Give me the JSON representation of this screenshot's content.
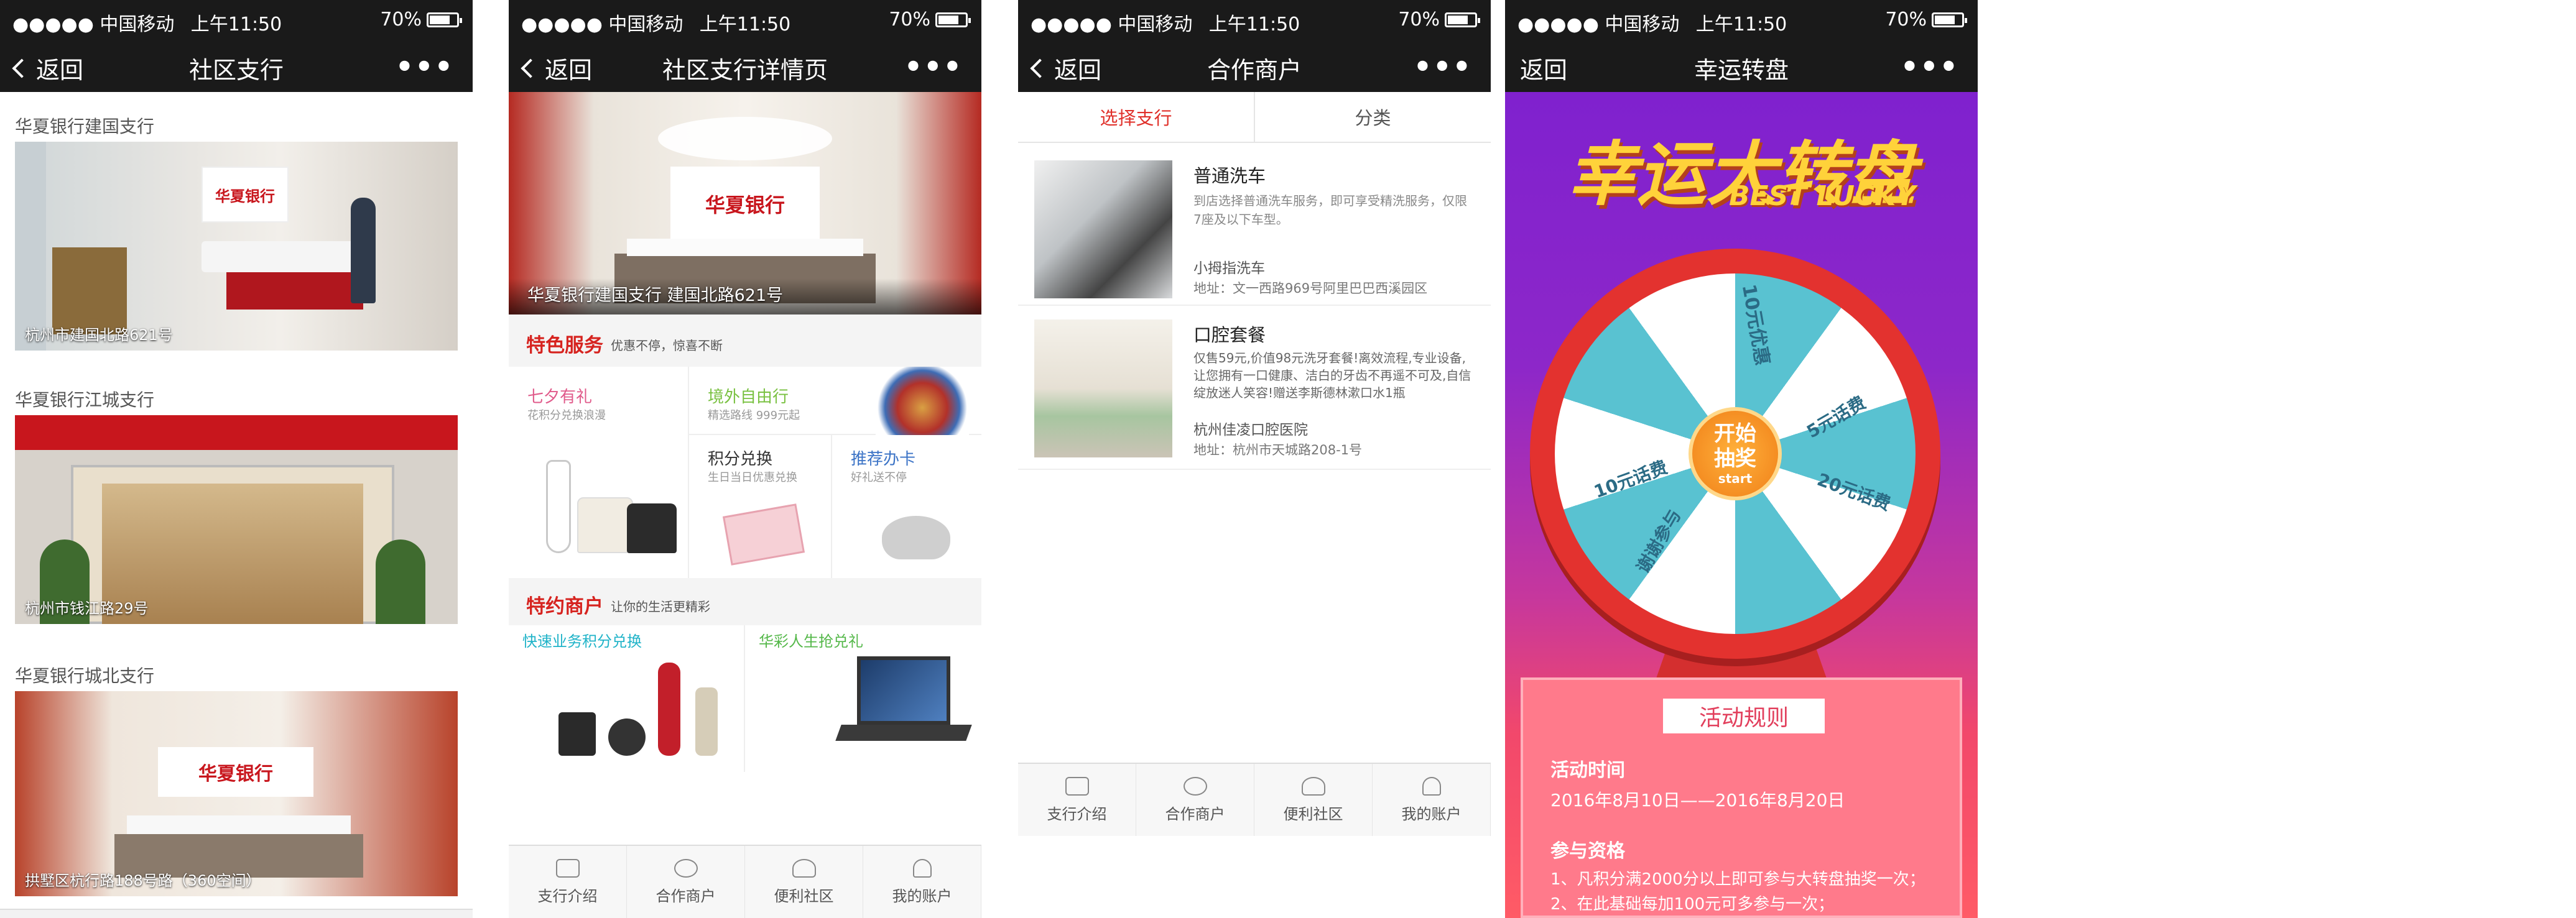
{
  "status": {
    "signal": "●●●●● 中国移动",
    "time": "上午11:50",
    "battery": "70%"
  },
  "screen1": {
    "back": "返回",
    "title": "社区支行",
    "more": "•••",
    "branches": [
      {
        "name": "华夏银行建国支行",
        "address": "杭州市建国北路621号"
      },
      {
        "name": "华夏银行江城支行",
        "address": "杭州市钱江路29号"
      },
      {
        "name": "华夏银行城北支行",
        "address": "拱墅区杭行路188号路（360空间）"
      }
    ],
    "logo": "华夏银行"
  },
  "screen2": {
    "back": "返回",
    "title": "社区支行详情页",
    "more": "•••",
    "banner": "华夏银行建国支行  建国北路621号",
    "logo": "华夏银行",
    "services_title": "特色服务",
    "services_sub": "优惠不停，惊喜不断",
    "services": [
      {
        "title": "七夕有礼",
        "sub": "花积分兑换浪漫",
        "color": "#e05a8a"
      },
      {
        "title": "境外自由行",
        "sub": "精选路线 999元起",
        "color": "#7ac142"
      },
      {
        "title": "积分兑换",
        "sub": "生日当日优惠兑换",
        "color": "#333333"
      },
      {
        "title": "推荐办卡",
        "sub": "好礼送不停",
        "color": "#3b73c6"
      }
    ],
    "merchants_title": "特约商户",
    "merchants_sub": "让你的生活更精彩",
    "merchants": [
      {
        "title": "快速业务积分兑换",
        "color": "#1fb3c8"
      },
      {
        "title": "华彩人生抢兑礼",
        "color": "#55b84a"
      }
    ],
    "tabs": [
      "支行介绍",
      "合作商户",
      "便利社区",
      "我的账户"
    ]
  },
  "screen3": {
    "back": "返回",
    "title": "合作商户",
    "more": "•••",
    "filters": [
      "选择支行",
      "分类"
    ],
    "items": [
      {
        "title": "普通洗车",
        "desc": "到店选择普通洗车服务，即可享受精洗服务，仅限7座及以下车型。",
        "shop": "小拇指洗车",
        "address": "地址：文一西路969号阿里巴巴西溪园区"
      },
      {
        "title": "口腔套餐",
        "desc": "仅售59元,价值98元洗牙套餐!离效流程,专业设备,让您拥有一口健康、洁白的牙齿不再遥不可及,自信绽放迷人笑容!赠送李斯德林漱口水1瓶",
        "shop": "杭州佳凌口腔医院",
        "address": "地址：杭州市天城路208-1号"
      }
    ],
    "tabs": [
      "支行介绍",
      "合作商户",
      "便利社区",
      "我的账户"
    ]
  },
  "screen4": {
    "back": "返回",
    "title": "幸运转盘",
    "more": "•••",
    "headline": "幸运大转盘",
    "headline_en": "BEST LUCKY",
    "wheel_center": "开始抽奖",
    "wheel_start": "start",
    "wheel_labels": [
      "10元优惠",
      "5元话费",
      "20元话费",
      "谢谢参与",
      "10元话费"
    ],
    "rules_title": "活动规则",
    "time_label": "活动时间",
    "time_value": "2016年8月10日——2016年8月20日",
    "eligibility_label": "参与资格",
    "rules": [
      "1、凡积分满2000分以上即可参与大转盘抽奖一次；",
      "2、在此基础每加100元可多参与一次；"
    ]
  }
}
